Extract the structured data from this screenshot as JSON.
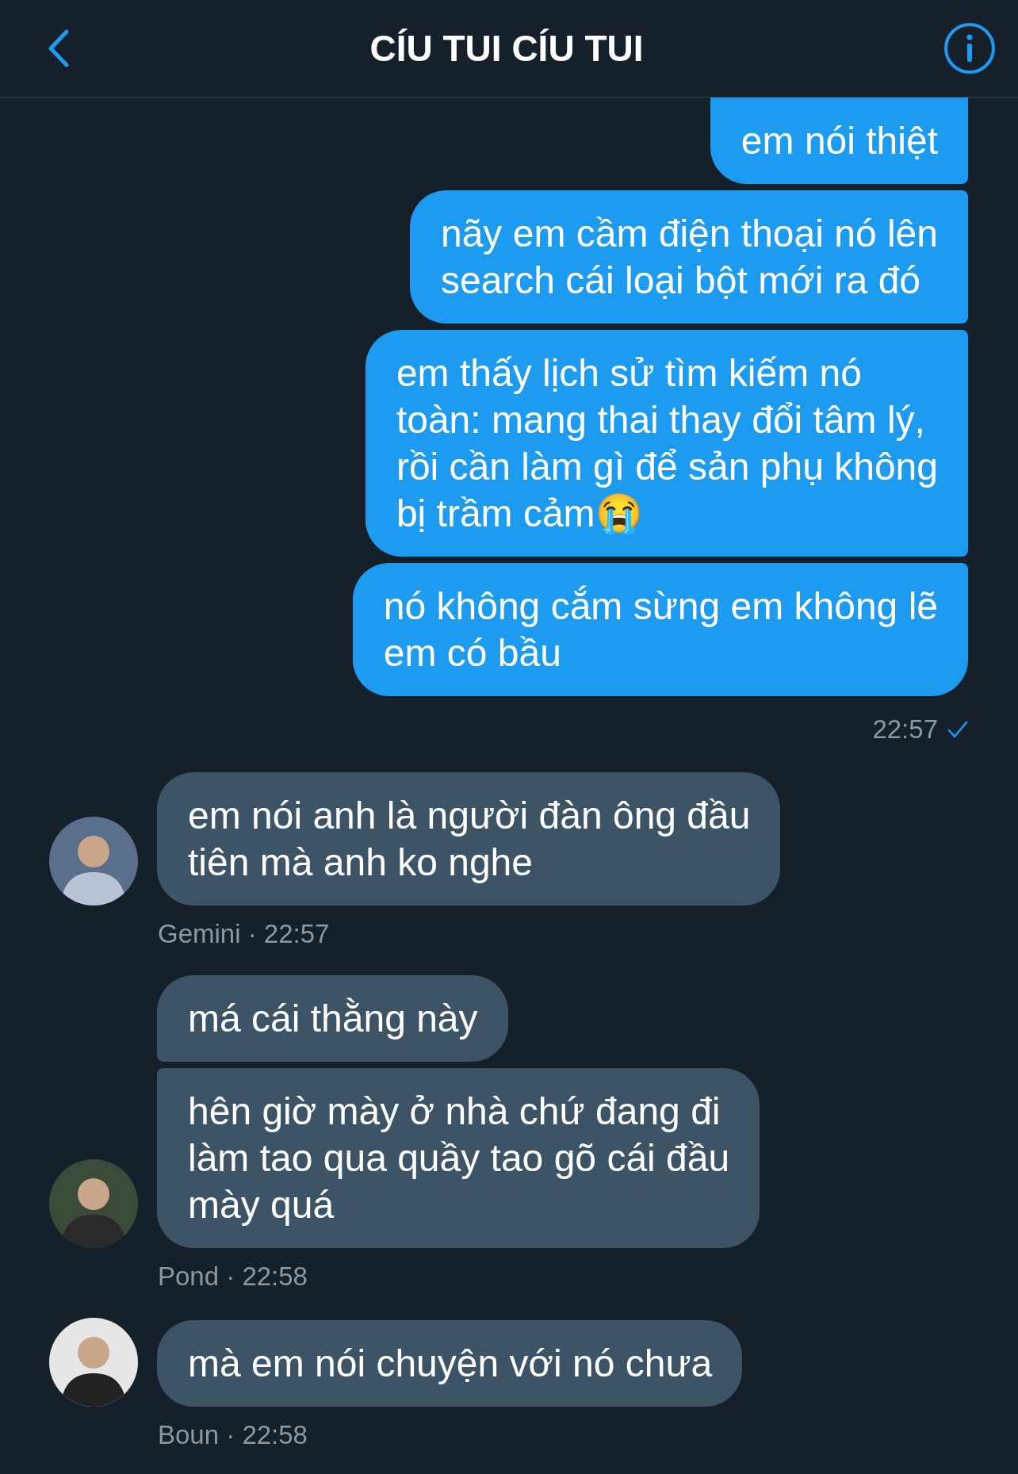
{
  "header": {
    "title": "CÍU TUI CÍU TUI"
  },
  "groups": [
    {
      "kind": "sent",
      "messages": [
        {
          "lines": [
            "em nói thiệt"
          ]
        },
        {
          "lines": [
            "nãy em cầm điện thoại nó lên",
            "search cái loại bột mới ra đó"
          ]
        },
        {
          "lines": [
            "em thấy lịch sử tìm kiếm nó",
            "toàn: mang thai thay đổi tâm lý,",
            "rồi cần làm gì để sản phụ không",
            "bị trầm cảm😭"
          ]
        },
        {
          "lines": [
            "nó không cắm sừng em không lẽ",
            "em có bầu"
          ]
        }
      ],
      "time": "22:57",
      "read": true
    },
    {
      "kind": "received",
      "messages": [
        {
          "lines": [
            "em nói anh là người đàn ông đầu",
            "tiên mà anh ko nghe"
          ]
        }
      ],
      "meta": "Gemini · 22:57"
    },
    {
      "kind": "received",
      "messages": [
        {
          "lines": [
            "má cái thằng này"
          ]
        },
        {
          "lines": [
            "hên giờ mày ở nhà chứ đang đi",
            "làm tao qua quầy tao gõ cái đầu",
            "mày quá"
          ]
        }
      ],
      "meta": "Pond · 22:58"
    },
    {
      "kind": "received",
      "messages": [
        {
          "lines": [
            "mà em nói chuyện với nó chưa"
          ]
        }
      ],
      "meta": "Boun · 22:58"
    }
  ]
}
